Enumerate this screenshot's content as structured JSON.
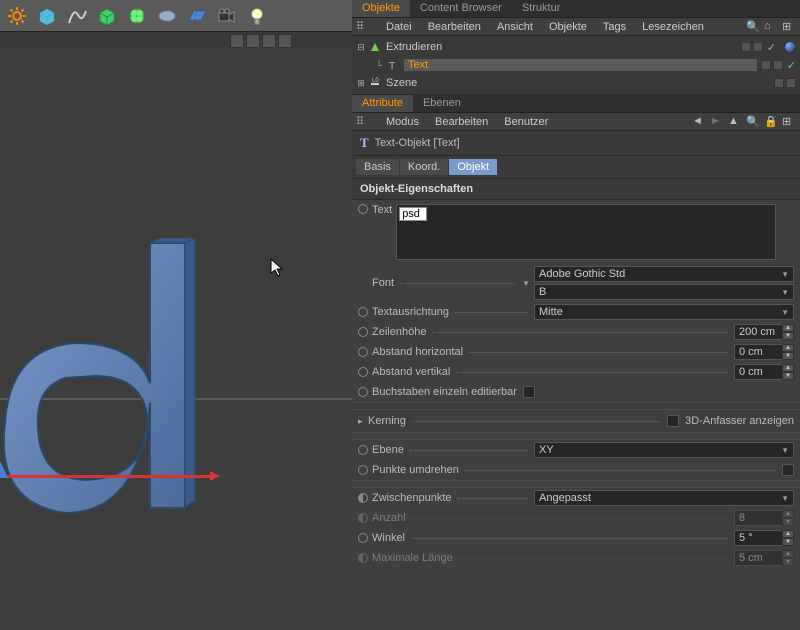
{
  "toolbar_icons": [
    "gear",
    "cube",
    "spline",
    "primitive",
    "deformer",
    "mograph",
    "plane",
    "camera",
    "light"
  ],
  "tabs_top": {
    "objects": "Objekte",
    "content": "Content Browser",
    "structure": "Struktur"
  },
  "obj_menu": [
    "Datei",
    "Bearbeiten",
    "Ansicht",
    "Objekte",
    "Tags",
    "Lesezeichen"
  ],
  "hierarchy": {
    "extrude": "Extrudieren",
    "text": "Text",
    "scene": "Szene"
  },
  "attr_tabs": {
    "attribute": "Attribute",
    "layers": "Ebenen"
  },
  "attr_menu": [
    "Modus",
    "Bearbeiten",
    "Benutzer"
  ],
  "attr_header": "Text-Objekt [Text]",
  "subtabs": {
    "basis": "Basis",
    "koord": "Koord.",
    "objekt": "Objekt"
  },
  "section": "Objekt-Eigenschaften",
  "props": {
    "text_label": "Text",
    "text_value": "psd",
    "font_label": "Font",
    "font_value": "Adobe Gothic Std",
    "font_weight": "B",
    "align_label": "Textausrichtung",
    "align_value": "Mitte",
    "lineheight_label": "Zeilenhöhe",
    "lineheight_value": "200 cm",
    "hspace_label": "Abstand horizontal",
    "hspace_value": "0 cm",
    "vspace_label": "Abstand vertikal",
    "vspace_value": "0 cm",
    "chars_editable": "Buchstaben einzeln editierbar",
    "kerning_label": "Kerning",
    "handles_3d": "3D-Anfasser anzeigen",
    "plane_label": "Ebene",
    "plane_value": "XY",
    "reverse_label": "Punkte umdrehen",
    "interp_label": "Zwischenpunkte",
    "interp_value": "Angepasst",
    "count_label": "Anzahl",
    "count_value": "8",
    "angle_label": "Winkel",
    "angle_value": "5 °",
    "maxlen_label": "Maximale Länge",
    "maxlen_value": "5 cm"
  }
}
